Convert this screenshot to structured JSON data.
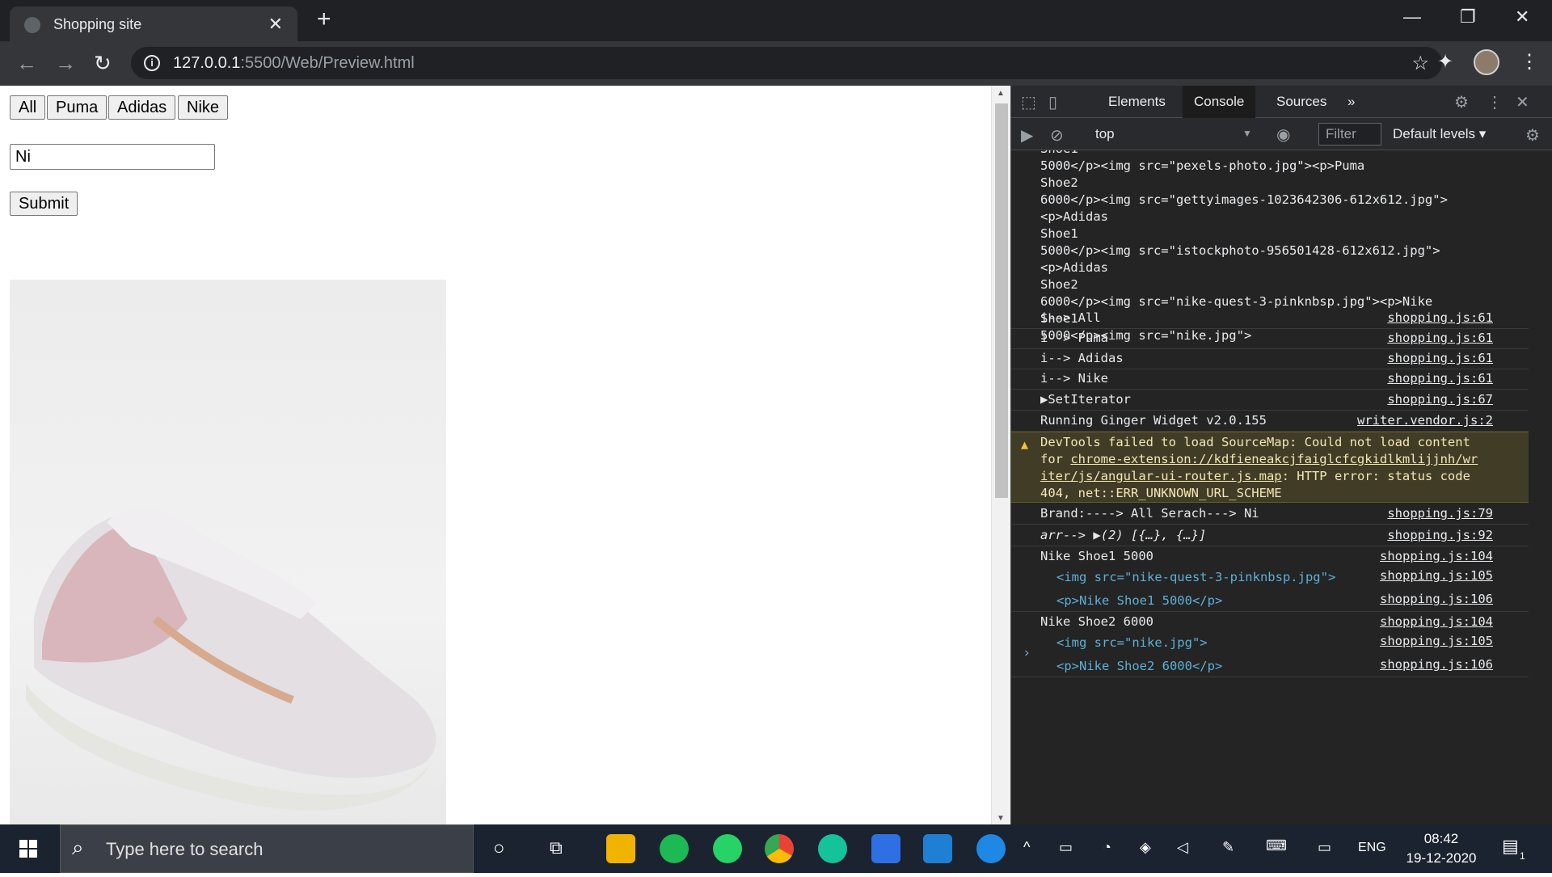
{
  "browser": {
    "tab_title": "Shopping site",
    "url_host": "127.0.0.1",
    "url_rest": ":5500/Web/Preview.html"
  },
  "page": {
    "brand_buttons": [
      "All",
      "Puma",
      "Adidas",
      "Nike"
    ],
    "search_value": "Ni",
    "submit_label": "Submit"
  },
  "devtools": {
    "tabs": [
      "Elements",
      "Console",
      "Sources"
    ],
    "more_tabs": "»",
    "context": "top",
    "filter_placeholder": "Filter",
    "levels": "Default levels",
    "console_head": "Shoe1\n5000</p><img src=\"pexels-photo.jpg\"><p>Puma\nShoe2\n6000</p><img src=\"gettyimages-1023642306-612x612.jpg\">\n<p>Adidas\nShoe1\n5000</p><img src=\"istockphoto-956501428-612x612.jpg\">\n<p>Adidas\nShoe2\n6000</p><img src=\"nike-quest-3-pinknbsp.jpg\"><p>Nike\nShoe1\n5000</p><img src=\"nike.jpg\">",
    "lines": [
      {
        "msg": "i--> All",
        "src": "shopping.js:61"
      },
      {
        "msg": "i--> Puma",
        "src": "shopping.js:61"
      },
      {
        "msg": "i--> Adidas",
        "src": "shopping.js:61"
      },
      {
        "msg": "i--> Nike",
        "src": "shopping.js:61"
      },
      {
        "msg": "▶SetIterator",
        "src": "shopping.js:67"
      },
      {
        "msg": "Running Ginger Widget v2.0.155",
        "src": "writer.vendor.js:2"
      }
    ],
    "warning": {
      "line1": "DevTools failed to load SourceMap: Could not load content",
      "line2_prefix": "for ",
      "line2_link": "chrome-extension://kdfieneakcjfaiglcfcgkidlkmlijjnh/wr",
      "line3_link": "iter/js/angular-ui-router.js.map",
      "line3_suffix": ": HTTP error: status code",
      "line4": "404, net::ERR_UNKNOWN_URL_SCHEME"
    },
    "lines2": [
      {
        "msg": "Brand:----> All Serach---> Ni",
        "src": "shopping.js:79"
      },
      {
        "msg": "arr--> ▶(2) [{…}, {…}]",
        "src": "shopping.js:92"
      },
      {
        "msg": "Nike Shoe1 5000",
        "src": "shopping.js:104"
      },
      {
        "msg": "<img src=\"nike-quest-3-pinknbsp.jpg\">",
        "src": "shopping.js:105"
      },
      {
        "msg": "<p>Nike Shoe1 5000</p>",
        "src": "shopping.js:106"
      },
      {
        "msg": "Nike Shoe2 6000",
        "src": "shopping.js:104"
      },
      {
        "msg": "<img src=\"nike.jpg\">",
        "src": "shopping.js:105"
      },
      {
        "msg": "<p>Nike Shoe2 6000</p>",
        "src": "shopping.js:106"
      }
    ],
    "prompt": "›"
  },
  "taskbar": {
    "search_placeholder": "Type here to search",
    "lang": "ENG",
    "time": "08:42",
    "date": "19-12-2020",
    "notification_count": "1"
  }
}
